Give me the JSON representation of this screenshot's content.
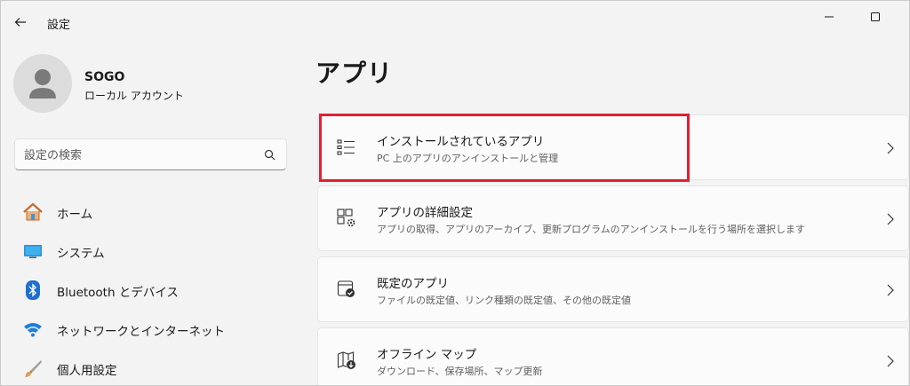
{
  "window": {
    "title": "設定"
  },
  "profile": {
    "name": "SOGO",
    "account_type": "ローカル アカウント"
  },
  "search": {
    "placeholder": "設定の検索"
  },
  "sidebar": {
    "items": [
      {
        "label": "ホーム",
        "icon": "home-icon"
      },
      {
        "label": "システム",
        "icon": "system-icon"
      },
      {
        "label": "Bluetooth とデバイス",
        "icon": "bluetooth-icon"
      },
      {
        "label": "ネットワークとインターネット",
        "icon": "wifi-icon"
      },
      {
        "label": "個人用設定",
        "icon": "brush-icon"
      }
    ]
  },
  "main": {
    "title": "アプリ",
    "cards": [
      {
        "title": "インストールされているアプリ",
        "desc": "PC 上のアプリのアンインストールと管理",
        "icon": "installed-apps-icon"
      },
      {
        "title": "アプリの詳細設定",
        "desc": "アプリの取得、アプリのアーカイブ、更新プログラムのアンインストールを行う場所を選択します",
        "icon": "advanced-app-settings-icon"
      },
      {
        "title": "既定のアプリ",
        "desc": "ファイルの既定値、リンク種類の既定値、その他の既定値",
        "icon": "default-apps-icon"
      },
      {
        "title": "オフライン マップ",
        "desc": "ダウンロード、保存場所、マップ更新",
        "icon": "offline-maps-icon"
      }
    ]
  },
  "colors": {
    "highlight": "#e4202e",
    "background": "#f3f3f3",
    "card": "#fbfbfb"
  }
}
